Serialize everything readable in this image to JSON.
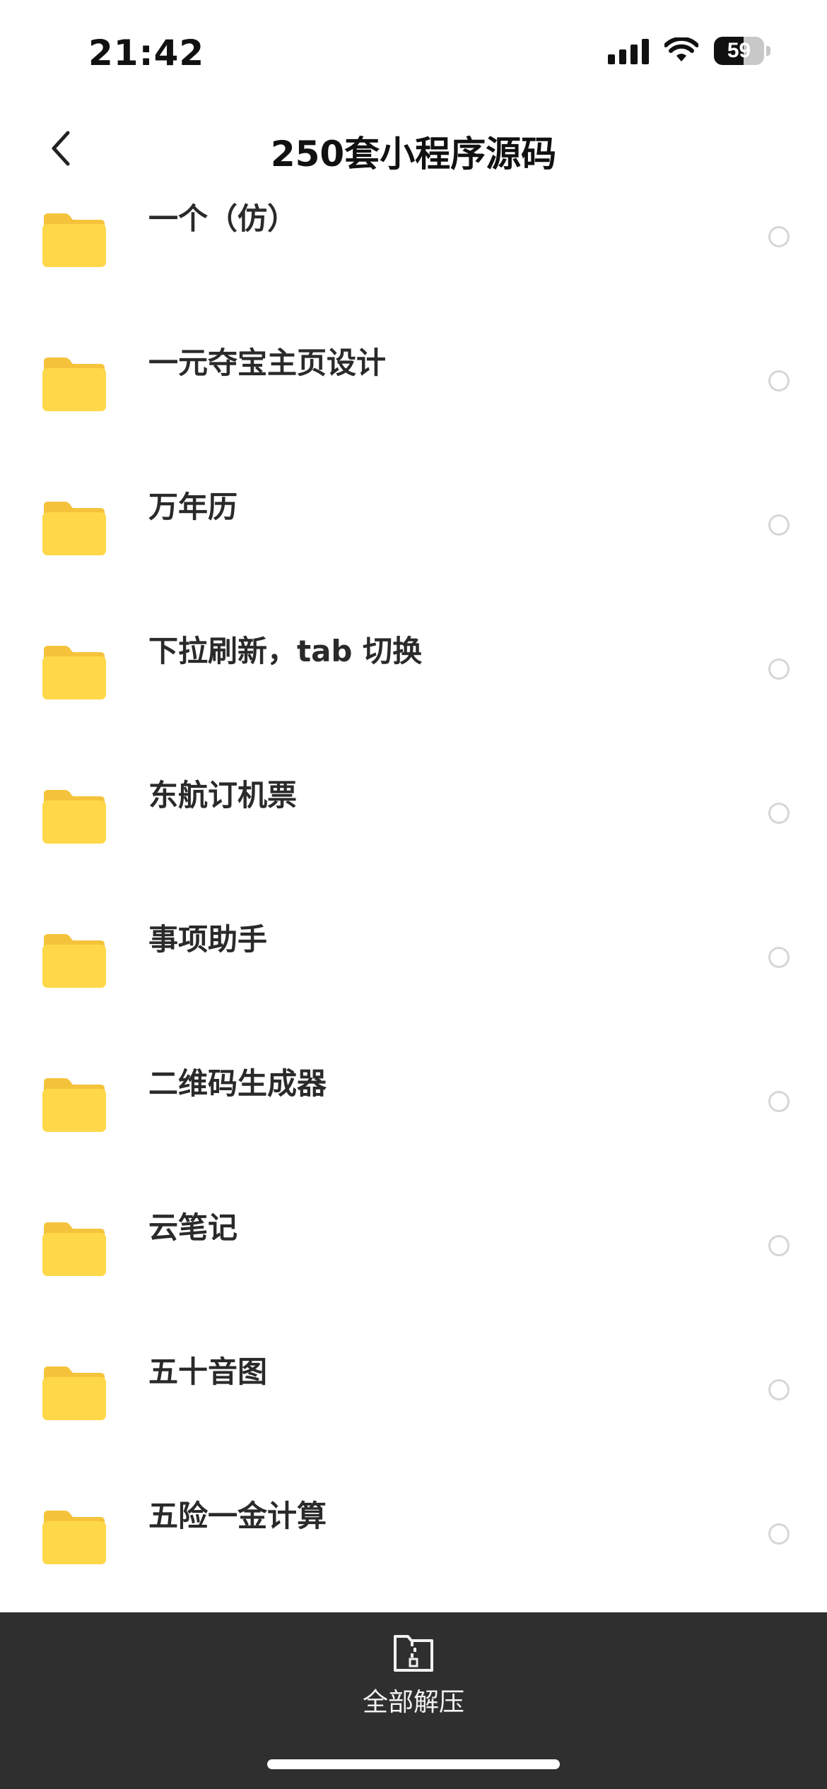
{
  "status_bar": {
    "time": "21:42",
    "battery_level": "59",
    "icons": [
      "cellular-signal-icon",
      "wifi-icon",
      "battery-icon"
    ]
  },
  "nav": {
    "title": "250套小程序源码",
    "back_icon": "chevron-left-icon"
  },
  "files": [
    {
      "name": "一个（仿）",
      "icon": "folder-icon",
      "selected": false
    },
    {
      "name": "一元夺宝主页设计",
      "icon": "folder-icon",
      "selected": false
    },
    {
      "name": "万年历",
      "icon": "folder-icon",
      "selected": false
    },
    {
      "name": "下拉刷新，tab 切换",
      "icon": "folder-icon",
      "selected": false
    },
    {
      "name": "东航订机票",
      "icon": "folder-icon",
      "selected": false
    },
    {
      "name": "事项助手",
      "icon": "folder-icon",
      "selected": false
    },
    {
      "name": "二维码生成器",
      "icon": "folder-icon",
      "selected": false
    },
    {
      "name": "云笔记",
      "icon": "folder-icon",
      "selected": false
    },
    {
      "name": "五十音图",
      "icon": "folder-icon",
      "selected": false
    },
    {
      "name": "五险一金计算",
      "icon": "folder-icon",
      "selected": false
    }
  ],
  "bottom_bar": {
    "extract_all_label": "全部解压",
    "extract_icon": "zip-file-icon"
  },
  "colors": {
    "folder": "#FFD84A",
    "folder_tab": "#F5C33B",
    "bottom_bar": "#2F2F2F",
    "radio_border": "#D6D6D6"
  }
}
